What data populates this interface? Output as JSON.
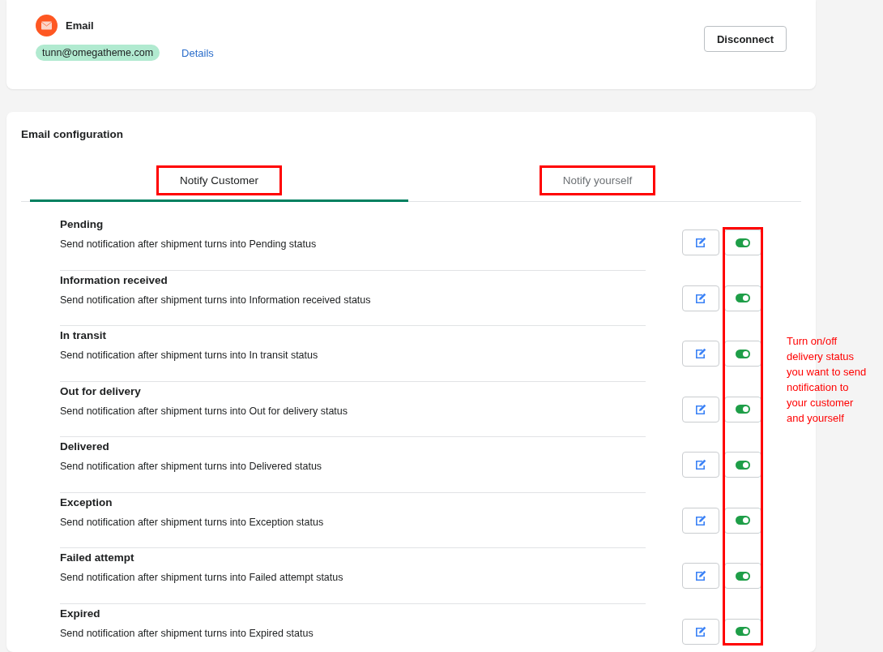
{
  "account": {
    "label": "Email",
    "address": "tunn@omegatheme.com",
    "details_link": "Details",
    "disconnect_button": "Disconnect"
  },
  "config": {
    "title": "Email configuration",
    "tabs": [
      {
        "label": "Notify Customer",
        "selected": true,
        "highlighted": true
      },
      {
        "label": "Notify yourself",
        "selected": false,
        "highlighted": true
      }
    ],
    "statuses": [
      {
        "title": "Pending",
        "description": "Send notification after shipment turns into Pending status",
        "enabled": true
      },
      {
        "title": "Information received",
        "description": "Send notification after shipment turns into Information received status",
        "enabled": true
      },
      {
        "title": "In transit",
        "description": "Send notification after shipment turns into In transit status",
        "enabled": true
      },
      {
        "title": "Out for delivery",
        "description": "Send notification after shipment turns into Out for delivery status",
        "enabled": true
      },
      {
        "title": "Delivered",
        "description": "Send notification after shipment turns into Delivered status",
        "enabled": true
      },
      {
        "title": "Exception",
        "description": "Send notification after shipment turns into Exception status",
        "enabled": true
      },
      {
        "title": "Failed attempt",
        "description": "Send notification after shipment turns into Failed attempt status",
        "enabled": true
      },
      {
        "title": "Expired",
        "description": "Send notification after shipment turns into Expired status",
        "enabled": true
      }
    ],
    "annotation": {
      "text": "Turn on/off delivery status you want to send notification to your customer and yourself",
      "highlight_toggles": true
    }
  }
}
